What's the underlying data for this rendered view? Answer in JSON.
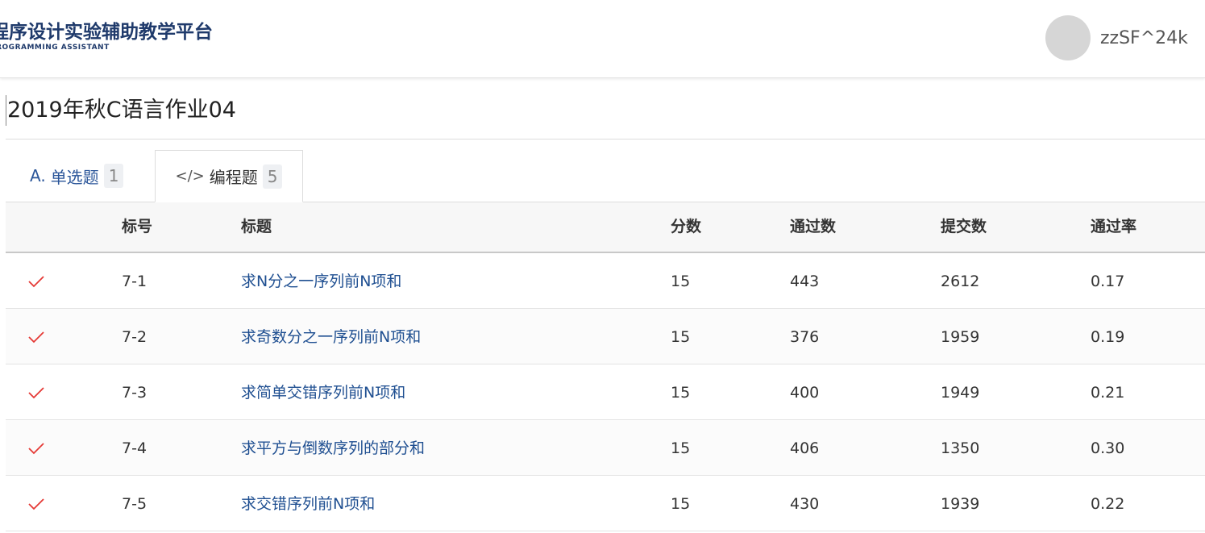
{
  "header": {
    "logo_main": "程序设计实验辅助教学平台",
    "logo_sub": "PROGRAMMING ASSISTANT",
    "username": "zzSF^24k"
  },
  "page": {
    "title": "2019年秋C语言作业04"
  },
  "tabs": [
    {
      "icon": "A.",
      "label": "单选题",
      "count": "1",
      "active": false
    },
    {
      "icon": "</>",
      "label": "编程题",
      "count": "5",
      "active": true
    }
  ],
  "table": {
    "columns": [
      "标号",
      "标题",
      "分数",
      "通过数",
      "提交数",
      "通过率"
    ],
    "rows": [
      {
        "status": "check-icon",
        "id": "7-1",
        "title": "求N分之一序列前N项和",
        "score": "15",
        "passed": "443",
        "submitted": "2612",
        "rate": "0.17"
      },
      {
        "status": "check-icon",
        "id": "7-2",
        "title": "求奇数分之一序列前N项和",
        "score": "15",
        "passed": "376",
        "submitted": "1959",
        "rate": "0.19"
      },
      {
        "status": "check-icon",
        "id": "7-3",
        "title": "求简单交错序列前N项和",
        "score": "15",
        "passed": "400",
        "submitted": "1949",
        "rate": "0.21"
      },
      {
        "status": "check-icon",
        "id": "7-4",
        "title": "求平方与倒数序列的部分和",
        "score": "15",
        "passed": "406",
        "submitted": "1350",
        "rate": "0.30"
      },
      {
        "status": "check-icon",
        "id": "7-5",
        "title": "求交错序列前N项和",
        "score": "15",
        "passed": "430",
        "submitted": "1939",
        "rate": "0.22"
      }
    ]
  },
  "colors": {
    "check": "#e53935",
    "link": "#1f4f91",
    "brand": "#1f3a6b"
  }
}
